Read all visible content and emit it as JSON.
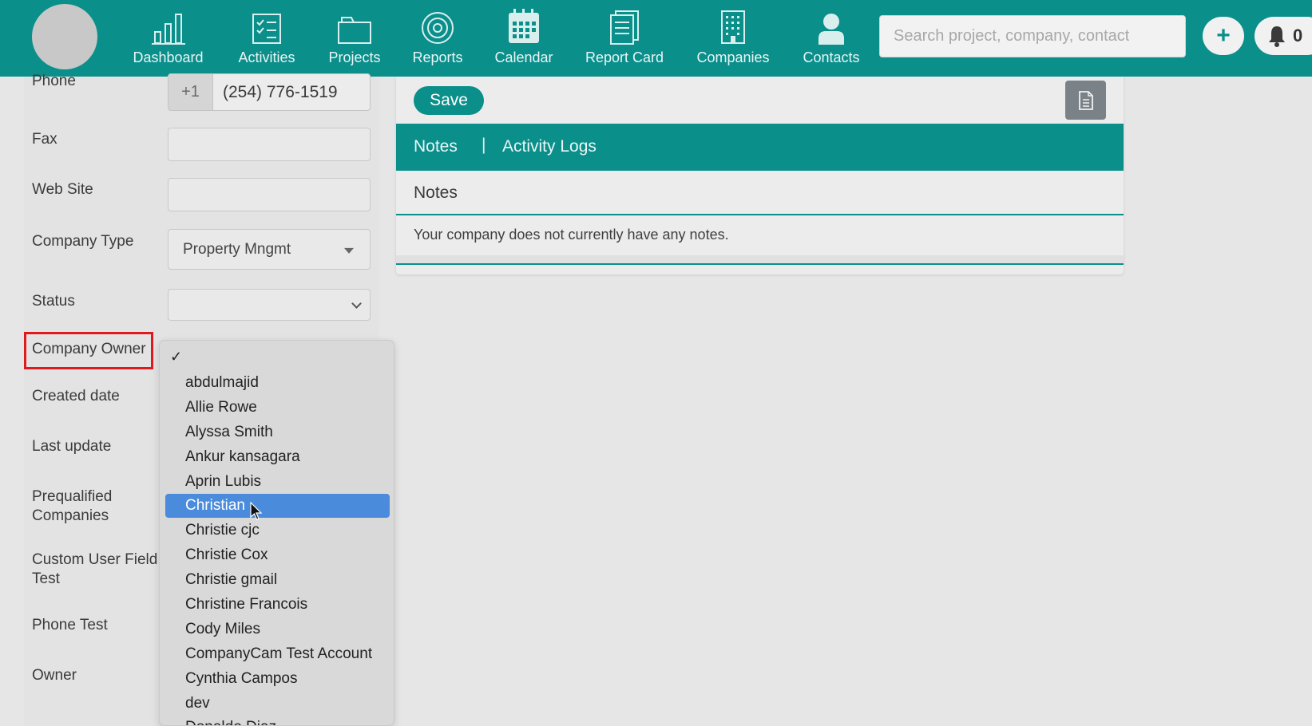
{
  "nav": {
    "items": [
      {
        "label": "Dashboard",
        "icon": "bar-chart-icon"
      },
      {
        "label": "Activities",
        "icon": "checklist-icon"
      },
      {
        "label": "Projects",
        "icon": "folder-icon"
      },
      {
        "label": "Reports",
        "icon": "target-icon"
      },
      {
        "label": "Calendar",
        "icon": "calendar-icon"
      },
      {
        "label": "Report Card",
        "icon": "report-card-icon"
      },
      {
        "label": "Companies",
        "icon": "building-icon"
      },
      {
        "label": "Contacts",
        "icon": "person-icon"
      }
    ],
    "search_placeholder": "Search project, company, contact",
    "add_symbol": "+",
    "notification_count": "0"
  },
  "form": {
    "phone_label": "Phone",
    "phone_prefix": "+1",
    "phone_value": "(254) 776-1519",
    "fax_label": "Fax",
    "website_label": "Web Site",
    "company_type_label": "Company Type",
    "company_type_value": "Property Mngmt",
    "status_label": "Status",
    "company_owner_label": "Company Owner",
    "created_date_label": "Created date",
    "last_update_label": "Last update",
    "prequalified_label_1": "Prequalified",
    "prequalified_label_2": "Companies",
    "custom_field_label_1": "Custom User Field",
    "custom_field_label_2": "Test",
    "phone_test_label": "Phone Test",
    "owner_label": "Owner"
  },
  "owner_dropdown": {
    "checkmark": "✓",
    "selected": "Christian",
    "options": [
      "abdulmajid",
      "Allie Rowe",
      "Alyssa Smith",
      "Ankur kansagara",
      "Aprin Lubis",
      "Christian",
      "Christie cjc",
      "Christie Cox",
      "Christie gmail",
      "Christine Francois",
      "Cody Miles",
      "CompanyCam Test Account",
      "Cynthia Campos",
      "dev",
      "Donaldo Diaz"
    ]
  },
  "notes_panel": {
    "save_label": "Save",
    "tab_notes": "Notes",
    "tab_separator": "|",
    "tab_activity_logs": "Activity Logs",
    "section_title": "Notes",
    "empty_message": "Your company does not currently have any notes."
  },
  "colors": {
    "brand_teal": "#0b8f8b",
    "selection_blue": "#4a8bdc",
    "highlight_red": "#e0191e"
  }
}
